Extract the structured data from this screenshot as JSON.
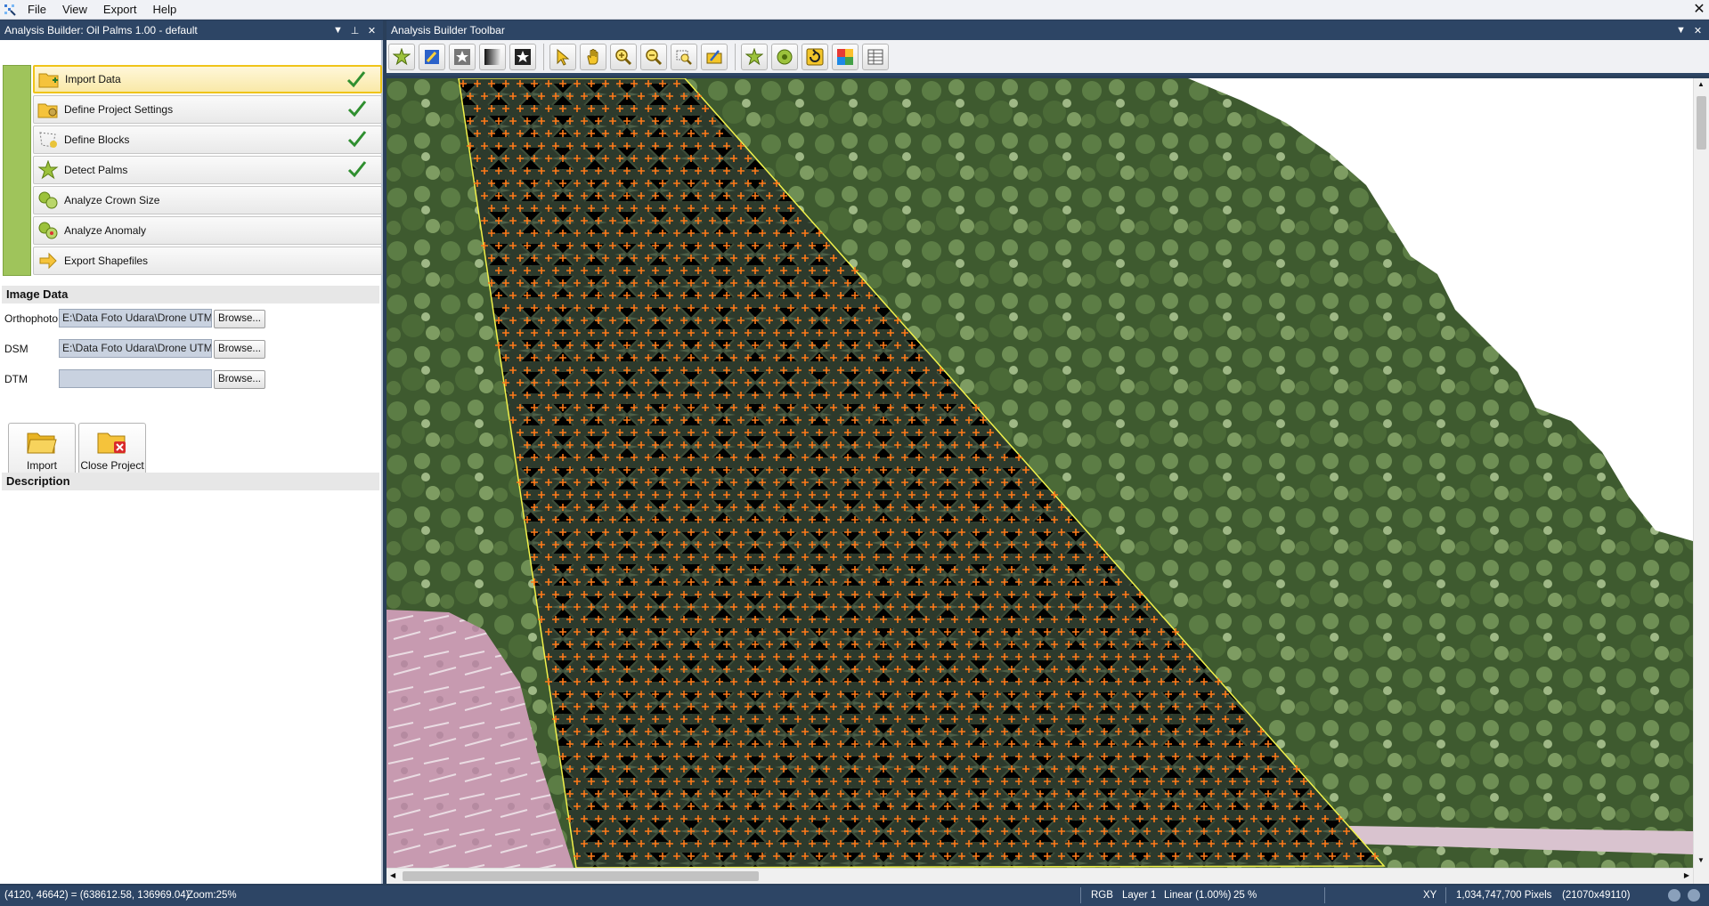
{
  "menubar": {
    "items": [
      "File",
      "View",
      "Export",
      "Help"
    ]
  },
  "left_panel": {
    "title": "Analysis Builder: Oil Palms 1.00 - default",
    "workflow_steps": [
      {
        "label": "Import Data",
        "icon": "folder-import-icon",
        "completed": true,
        "active": true
      },
      {
        "label": "Define Project Settings",
        "icon": "folder-settings-icon",
        "completed": true,
        "active": false
      },
      {
        "label": "Define Blocks",
        "icon": "blocks-icon",
        "completed": true,
        "active": false
      },
      {
        "label": "Detect Palms",
        "icon": "palm-star-icon",
        "completed": true,
        "active": false
      },
      {
        "label": "Analyze Crown Size",
        "icon": "crown-analysis-icon",
        "completed": false,
        "active": false
      },
      {
        "label": "Analyze Anomaly",
        "icon": "anomaly-analysis-icon",
        "completed": false,
        "active": false
      },
      {
        "label": "Export Shapefiles",
        "icon": "export-arrow-icon",
        "completed": false,
        "active": false
      }
    ],
    "image_data": {
      "title": "Image Data",
      "orthophoto_label": "Orthophoto",
      "orthophoto_value": "E:\\Data Foto Udara\\Drone UTMU",
      "dsm_label": "DSM",
      "dsm_value": "E:\\Data Foto Udara\\Drone UTMU",
      "dtm_label": "DTM",
      "dtm_value": "",
      "browse_label": "Browse..."
    },
    "buttons": {
      "import_label": "Import",
      "close_project_label": "Close Project"
    },
    "description_title": "Description"
  },
  "right_panel": {
    "title": "Analysis Builder Toolbar"
  },
  "statusbar": {
    "coords": "(4120, 46642) = (638612.58, 136969.04)",
    "zoom_text": "Zoom:25%",
    "mode": "RGB",
    "layer": "Layer 1",
    "stretch": "Linear (1.00%)",
    "zoom_pct": "25 %",
    "xy": "XY",
    "pixels": "1,034,747,700 Pixels",
    "dims": "(21070x49110)"
  },
  "colors": {
    "header_bg": "#2d4565",
    "workflow_green": "#9fc45b",
    "active_step_border": "#f0c419",
    "palm_marker": "#ff7a1a",
    "block_boundary": "#f2f24a"
  }
}
